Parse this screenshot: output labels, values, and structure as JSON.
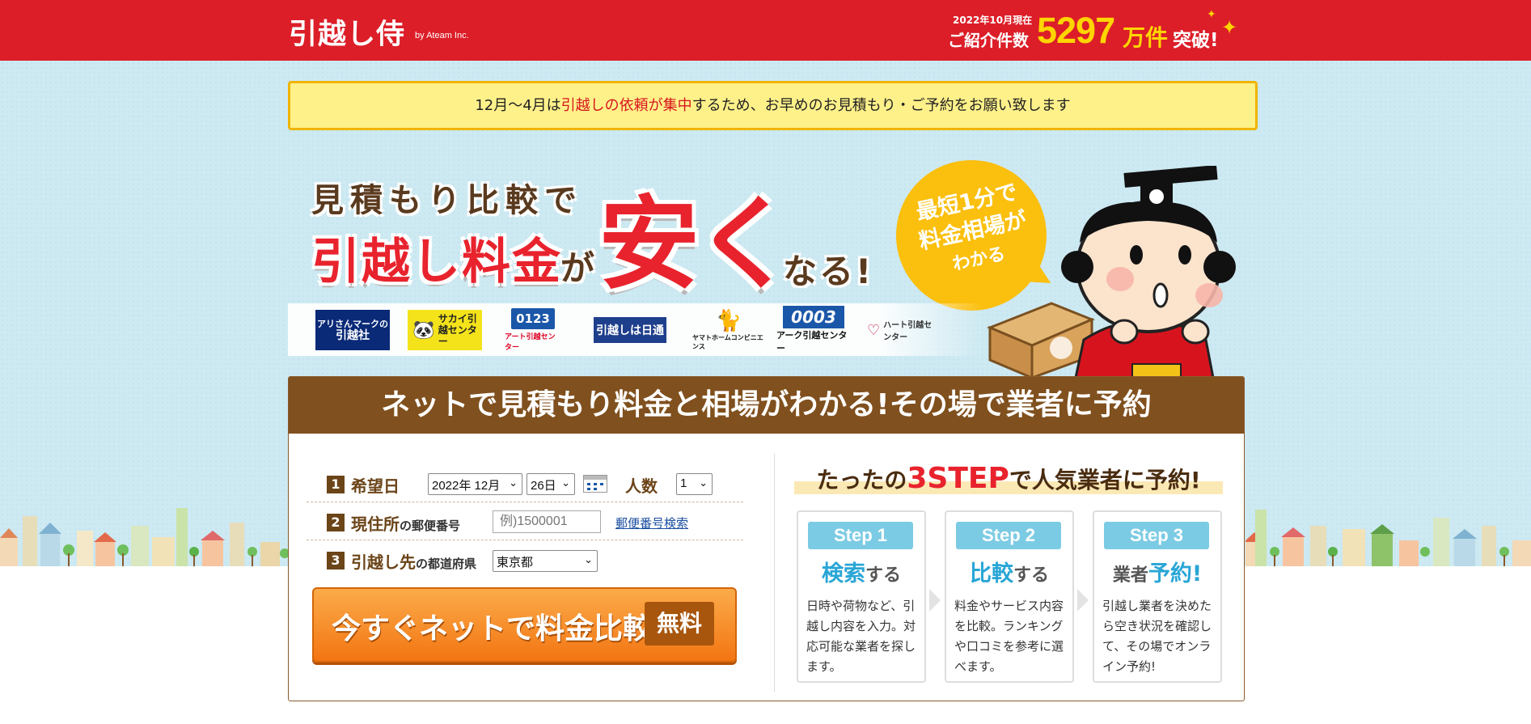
{
  "header": {
    "logo": "引越し侍",
    "logo_by": "by Ateam Inc.",
    "referral_date": "2022年10月現在",
    "referral_label": "ご紹介件数",
    "referral_count": "5297",
    "referral_unit": "万件",
    "referral_suffix": "突破!"
  },
  "notice": {
    "prefix": "12月〜4月は",
    "highlight": "引越しの依頼が集中",
    "suffix": "するため、お早めのお見積もり・ご予約をお願い致します"
  },
  "hero": {
    "line1": "見積もり比較で",
    "line2": "引越し料金",
    "ga": "が",
    "yasuku": "安く",
    "naru": "なる!",
    "bubble_line1": "最短1分で",
    "bubble_line2": "料金相場が",
    "bubble_line3": "わかる"
  },
  "brands": {
    "ari_line1": "アリさんマークの",
    "ari_line2": "引越社",
    "sakai": "サカイ引越センター",
    "art_num": "0123",
    "art_caption": "アート引越センター",
    "nittsu": "引越しは日通",
    "yamato": "ヤマトホームコンビニエンス",
    "ark_num": "0003",
    "ark_caption": "アーク引越センター",
    "heart": "ハート引越センター"
  },
  "panel": {
    "title": "ネットで見積もり料金と相場がわかる!その場で業者に予約"
  },
  "form": {
    "row1_num": "1",
    "row1_label": "希望日",
    "year_month": "2022年 12月",
    "day": "26日",
    "people_label": "人数",
    "people": "1",
    "row2_num": "2",
    "row2_label": "現住所",
    "row2_sub": "の郵便番号",
    "zip_placeholder": "例)1500001",
    "zip_link": "郵便番号検索",
    "row3_num": "3",
    "row3_label": "引越し先",
    "row3_sub": "の都道府県",
    "prefecture": "東京都",
    "cta_label": "今すぐネットで料金比較",
    "cta_free": "無料"
  },
  "steps": {
    "title_prefix": "たったの",
    "title_big": "3STEP",
    "title_suffix": "で人気業者に予約!",
    "items": [
      {
        "badge": "Step 1",
        "head_c": "検索",
        "head_tail": "する",
        "head_pre": "",
        "desc": "日時や荷物など、引越し内容を入力。対応可能な業者を探します。"
      },
      {
        "badge": "Step 2",
        "head_c": "比較",
        "head_tail": "する",
        "head_pre": "",
        "desc": "料金やサービス内容を比較。ランキングや口コミを参考に選べます。"
      },
      {
        "badge": "Step 3",
        "head_pre": "業者",
        "head_c": "予約!",
        "head_tail": "",
        "desc": "引越し業者を決めたら空き状況を確認して、その場でオンライン予約!"
      }
    ]
  },
  "colors": {
    "brand_red": "#dc1e28",
    "accent_yellow": "#ffd500",
    "panel_brown": "#80501e",
    "cta_orange": "#f37512",
    "step_blue": "#29a6d6"
  }
}
